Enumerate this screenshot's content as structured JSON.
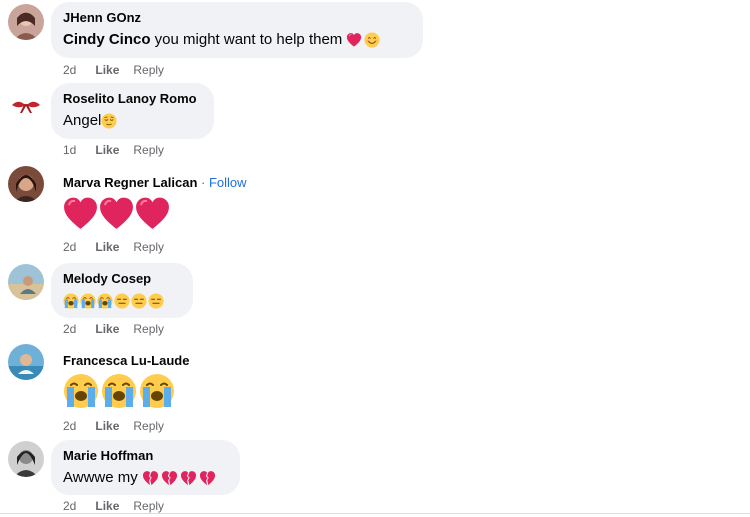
{
  "comments": [
    {
      "author": "JHenn GOnz",
      "mention": "Cindy Cinco",
      "text": " you might want to help them",
      "emojis": [
        "red-heart",
        "smiling-face"
      ],
      "time": "2d",
      "like": "Like",
      "reply": "Reply"
    },
    {
      "author": "Roselito Lanoy Romo",
      "text": "Angel",
      "emojis": [
        "relieved-face"
      ],
      "time": "1d",
      "like": "Like",
      "reply": "Reply"
    },
    {
      "author": "Marva Regner Lalican",
      "separator": " · ",
      "follow": "Follow",
      "text": "",
      "emojis": [
        "red-heart",
        "red-heart",
        "red-heart"
      ],
      "time": "2d",
      "like": "Like",
      "reply": "Reply"
    },
    {
      "author": "Melody Cosep",
      "text": "",
      "emojis": [
        "crying-face",
        "crying-face",
        "crying-face",
        "expressionless-face",
        "expressionless-face",
        "expressionless-face"
      ],
      "time": "2d",
      "like": "Like",
      "reply": "Reply"
    },
    {
      "author": "Francesca Lu-Laude",
      "text": "",
      "emojis": [
        "crying-face",
        "crying-face",
        "crying-face"
      ],
      "time": "2d",
      "like": "Like",
      "reply": "Reply"
    },
    {
      "author": "Marie Hoffman",
      "text": "Awwwe my ",
      "emojis": [
        "broken-heart",
        "broken-heart",
        "broken-heart",
        "broken-heart"
      ],
      "time": "2d",
      "like": "Like",
      "reply": "Reply"
    }
  ],
  "colors": {
    "bubble": "#f0f2f5",
    "meta": "#65676b",
    "link": "#216fdb",
    "heart": "#e0245e"
  }
}
